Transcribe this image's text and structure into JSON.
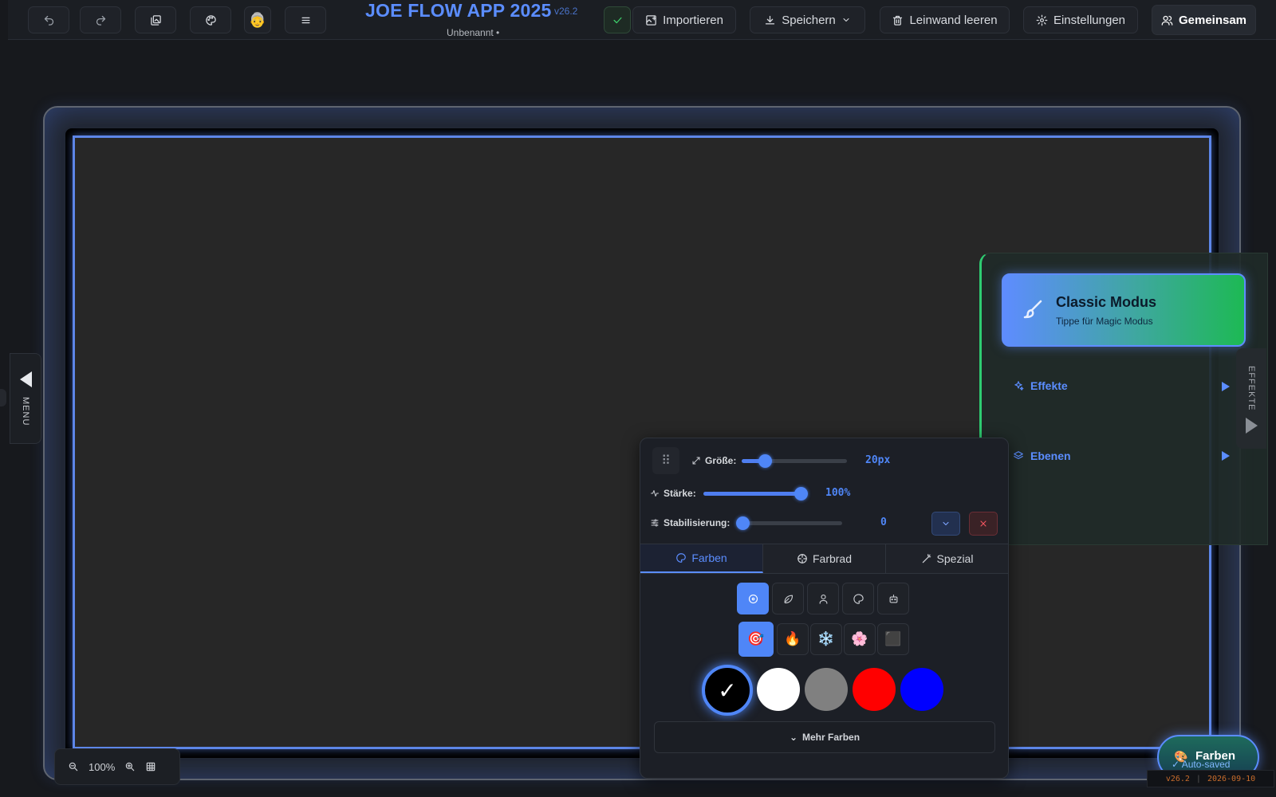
{
  "header": {
    "title": "JOE FLOW APP 2025",
    "version": "v26.2",
    "subtitle": "Unbenannt •",
    "import_label": "Importieren",
    "save_label": "Speichern",
    "clear_label": "Leinwand leeren",
    "settings_label": "Einstellungen",
    "shared_label": "Gemeinsam",
    "avatar_emoji": "👵"
  },
  "left_menu": {
    "label": "MENU"
  },
  "right_panel": {
    "mode_title": "Classic Modus",
    "mode_subtitle": "Tippe für Magic Modus",
    "effects_label": "Effekte",
    "layers_label": "Ebenen",
    "handle_label": "EFFEKTE"
  },
  "brush_panel": {
    "size_label": "Größe:",
    "size_value": "20px",
    "size_fraction": 0.22,
    "strength_label": "Stärke:",
    "strength_value": "100%",
    "strength_fraction": 1.0,
    "stabilization_label": "Stabilisierung:",
    "stabilization_value": "0",
    "stabilization_fraction": 0.0,
    "tabs": [
      {
        "label": "Farben",
        "icon": "palette-icon",
        "active": true
      },
      {
        "label": "Farbrad",
        "icon": "color-wheel-icon",
        "active": false
      },
      {
        "label": "Spezial",
        "icon": "magic-wand-icon",
        "active": false
      }
    ],
    "categories_row1": [
      "target-icon",
      "leaf-icon",
      "person-icon",
      "palette-icon",
      "robot-icon"
    ],
    "categories_row2": [
      {
        "emoji": "🎯",
        "name": "dart-icon"
      },
      {
        "emoji": "🔥",
        "name": "fire-icon"
      },
      {
        "emoji": "❄️",
        "name": "snowflake-icon"
      },
      {
        "emoji": "🌸",
        "name": "blossom-icon"
      },
      {
        "emoji": "⬛",
        "name": "black-square-icon"
      }
    ],
    "swatches": [
      {
        "color": "#000000",
        "selected": true
      },
      {
        "color": "#ffffff",
        "selected": false
      },
      {
        "color": "#808080",
        "selected": false
      },
      {
        "color": "#ff0000",
        "selected": false
      },
      {
        "color": "#0000ff",
        "selected": false
      }
    ],
    "selected_mark": "✓",
    "more_colors_label": "Mehr Farben"
  },
  "zoom": {
    "level": "100%"
  },
  "fab": {
    "label": "Farben",
    "emoji": "🎨"
  },
  "status": {
    "autosaved": "✓ Auto-saved",
    "version": "v26.2",
    "date": "2026-09-10"
  },
  "colors": {
    "accent": "#5b8dff",
    "success": "#2ecc71",
    "danger": "#f2555f"
  }
}
